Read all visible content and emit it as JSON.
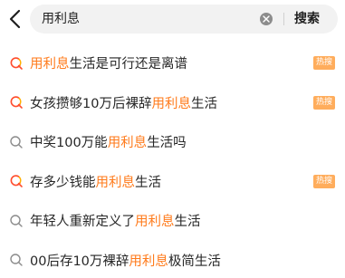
{
  "search": {
    "query": "用利息",
    "submit_label": "搜索"
  },
  "colors": {
    "highlight": "#ff7a1a",
    "hot_badge_bg": "#ffad5c",
    "search_bg": "#f2f2f2"
  },
  "suggestions": [
    {
      "parts": [
        {
          "t": "用利息",
          "hl": true
        },
        {
          "t": "生活是可行还是离谱",
          "hl": false
        }
      ],
      "icon": "hot-search-icon",
      "badge": "热搜"
    },
    {
      "parts": [
        {
          "t": "女孩攒够10万后裸辞",
          "hl": false
        },
        {
          "t": "用利息",
          "hl": true
        },
        {
          "t": "生活",
          "hl": false
        }
      ],
      "icon": "hot-search-icon",
      "badge": "热搜"
    },
    {
      "parts": [
        {
          "t": "中奖100万能",
          "hl": false
        },
        {
          "t": "用利息",
          "hl": true
        },
        {
          "t": "生活吗",
          "hl": false
        }
      ],
      "icon": "search-icon",
      "badge": ""
    },
    {
      "parts": [
        {
          "t": "存多少钱能",
          "hl": false
        },
        {
          "t": "用利息",
          "hl": true
        },
        {
          "t": "生活",
          "hl": false
        }
      ],
      "icon": "hot-search-icon",
      "badge": "热搜"
    },
    {
      "parts": [
        {
          "t": "年轻人重新定义了",
          "hl": false
        },
        {
          "t": "用利息",
          "hl": true
        },
        {
          "t": "生活",
          "hl": false
        }
      ],
      "icon": "search-icon",
      "badge": ""
    },
    {
      "parts": [
        {
          "t": "00后存10万裸辞",
          "hl": false
        },
        {
          "t": "用利息",
          "hl": true
        },
        {
          "t": "极简生活",
          "hl": false
        }
      ],
      "icon": "search-icon",
      "badge": ""
    }
  ]
}
